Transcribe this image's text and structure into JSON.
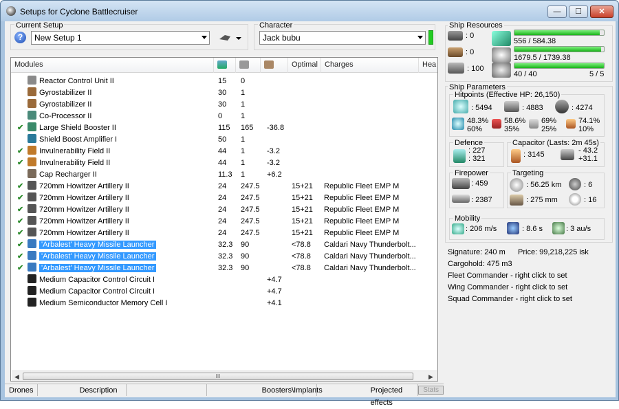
{
  "window": {
    "title": "Setups for Cyclone Battlecruiser",
    "min": "—",
    "max": "☐",
    "close": "✕"
  },
  "setup": {
    "label": "Current Setup",
    "value": "New Setup 1",
    "help": "?"
  },
  "character": {
    "label": "Character",
    "value": "Jack bubu"
  },
  "columns": [
    "Modules",
    "",
    "",
    "",
    "Optimal",
    "Charges",
    "Hea"
  ],
  "modules": [
    {
      "check": "",
      "name": "Reactor Control Unit II",
      "pg": "15",
      "cpu": "0",
      "cap": "",
      "opt": "",
      "charge": "",
      "sel": false,
      "icon": "#8a8a8a"
    },
    {
      "check": "",
      "name": "Gyrostabilizer II",
      "pg": "30",
      "cpu": "1",
      "cap": "",
      "opt": "",
      "charge": "",
      "sel": false,
      "icon": "#9a6a3a"
    },
    {
      "check": "",
      "name": "Gyrostabilizer II",
      "pg": "30",
      "cpu": "1",
      "cap": "",
      "opt": "",
      "charge": "",
      "sel": false,
      "icon": "#9a6a3a"
    },
    {
      "check": "",
      "name": "Co-Processor II",
      "pg": "0",
      "cpu": "1",
      "cap": "",
      "opt": "",
      "charge": "",
      "sel": false,
      "icon": "#4a8a7a"
    },
    {
      "check": "✔",
      "name": "Large Shield Booster II",
      "pg": "115",
      "cpu": "165",
      "cap": "-36.8",
      "opt": "",
      "charge": "",
      "sel": false,
      "icon": "#3a8a6a"
    },
    {
      "check": "",
      "name": "Shield Boost Amplifier I",
      "pg": "50",
      "cpu": "1",
      "cap": "",
      "opt": "",
      "charge": "",
      "sel": false,
      "icon": "#2a7a9a"
    },
    {
      "check": "✔",
      "name": "Invulnerability Field II",
      "pg": "44",
      "cpu": "1",
      "cap": "-3.2",
      "opt": "",
      "charge": "",
      "sel": false,
      "icon": "#c07a2a"
    },
    {
      "check": "✔",
      "name": "Invulnerability Field II",
      "pg": "44",
      "cpu": "1",
      "cap": "-3.2",
      "opt": "",
      "charge": "",
      "sel": false,
      "icon": "#c07a2a"
    },
    {
      "check": "",
      "name": "Cap Recharger II",
      "pg": "11.3",
      "cpu": "1",
      "cap": "+6.2",
      "opt": "",
      "charge": "",
      "sel": false,
      "icon": "#7a6a5a"
    },
    {
      "check": "✔",
      "name": "720mm Howitzer Artillery II",
      "pg": "24",
      "cpu": "247.5",
      "cap": "",
      "opt": "15+21",
      "charge": "Republic Fleet EMP M",
      "sel": false,
      "icon": "#555"
    },
    {
      "check": "✔",
      "name": "720mm Howitzer Artillery II",
      "pg": "24",
      "cpu": "247.5",
      "cap": "",
      "opt": "15+21",
      "charge": "Republic Fleet EMP M",
      "sel": false,
      "icon": "#555"
    },
    {
      "check": "✔",
      "name": "720mm Howitzer Artillery II",
      "pg": "24",
      "cpu": "247.5",
      "cap": "",
      "opt": "15+21",
      "charge": "Republic Fleet EMP M",
      "sel": false,
      "icon": "#555"
    },
    {
      "check": "✔",
      "name": "720mm Howitzer Artillery II",
      "pg": "24",
      "cpu": "247.5",
      "cap": "",
      "opt": "15+21",
      "charge": "Republic Fleet EMP M",
      "sel": false,
      "icon": "#555"
    },
    {
      "check": "✔",
      "name": "720mm Howitzer Artillery II",
      "pg": "24",
      "cpu": "247.5",
      "cap": "",
      "opt": "15+21",
      "charge": "Republic Fleet EMP M",
      "sel": false,
      "icon": "#555"
    },
    {
      "check": "✔",
      "name": "'Arbalest' Heavy Missile Launcher",
      "pg": "32.3",
      "cpu": "90",
      "cap": "",
      "opt": "<78.8",
      "charge": "Caldari Navy Thunderbolt...",
      "sel": true,
      "icon": "#3a7ac0"
    },
    {
      "check": "✔",
      "name": "'Arbalest' Heavy Missile Launcher",
      "pg": "32.3",
      "cpu": "90",
      "cap": "",
      "opt": "<78.8",
      "charge": "Caldari Navy Thunderbolt...",
      "sel": true,
      "icon": "#3a7ac0"
    },
    {
      "check": "✔",
      "name": "'Arbalest' Heavy Missile Launcher",
      "pg": "32.3",
      "cpu": "90",
      "cap": "",
      "opt": "<78.8",
      "charge": "Caldari Navy Thunderbolt...",
      "sel": true,
      "icon": "#3a7ac0"
    },
    {
      "check": "",
      "name": "Medium Capacitor Control Circuit I",
      "pg": "",
      "cpu": "",
      "cap": "+4.7",
      "opt": "",
      "charge": "",
      "sel": false,
      "icon": "#222"
    },
    {
      "check": "",
      "name": "Medium Capacitor Control Circuit I",
      "pg": "",
      "cpu": "",
      "cap": "+4.7",
      "opt": "",
      "charge": "",
      "sel": false,
      "icon": "#222"
    },
    {
      "check": "",
      "name": "Medium Semiconductor Memory Cell I",
      "pg": "",
      "cpu": "",
      "cap": "+4.1",
      "opt": "",
      "charge": "",
      "sel": false,
      "icon": "#222"
    }
  ],
  "scroll_grip": "III",
  "tabs": [
    "Drones",
    "Description",
    "Boosters\\Implants",
    "Projected effects",
    "Stats"
  ],
  "resources": {
    "label": "Ship Resources",
    "hardpoints": [
      ": 0",
      ": 0",
      ": 100"
    ],
    "cpu": "556 / 584.38",
    "cpu_fill": 0.951,
    "pg": "1679.5 / 1739.38",
    "pg_fill": 0.966,
    "bay": "40 / 40",
    "bay_fill": 1.0,
    "slots": "5 / 5"
  },
  "params": {
    "label": "Ship Parameters",
    "hp_label": "Hitpoints (Effective HP: 26,150)",
    "shield": ": 5494",
    "armor": ": 4883",
    "hull": ": 4274",
    "res1_a": "48.3%",
    "res1_b": "60%",
    "res2_a": "58.6%",
    "res2_b": "35%",
    "res3_a": "69%",
    "res3_b": "25%",
    "res4_a": "74.1%",
    "res4_b": "10%",
    "defence_label": "Defence",
    "def_a": ": 227",
    "def_b": ": 321",
    "cap_label": "Capacitor (Lasts: 2m 45s)",
    "cap_val": ": 3145",
    "cap_a": "- 43.2",
    "cap_b": "+31.1",
    "fire_label": "Firepower",
    "fire_a": ": 459",
    "fire_b": ": 2387",
    "tgt_label": "Targeting",
    "tgt_range": ": 56.25 km",
    "tgt_count": ": 6",
    "tgt_res": ": 275 mm",
    "tgt_scan": ": 16",
    "mob_label": "Mobility",
    "speed": ": 206 m/s",
    "align": ": 8.6 s",
    "warp": ": 3 au/s",
    "signature": "Signature: 240 m",
    "price": "Price: 99,218,225 isk",
    "cargo": "Cargohold: 475 m3",
    "fleet": "Fleet Commander - right click to set",
    "wing": "Wing Commander - right click to set",
    "squad": "Squad Commander - right click to set"
  }
}
